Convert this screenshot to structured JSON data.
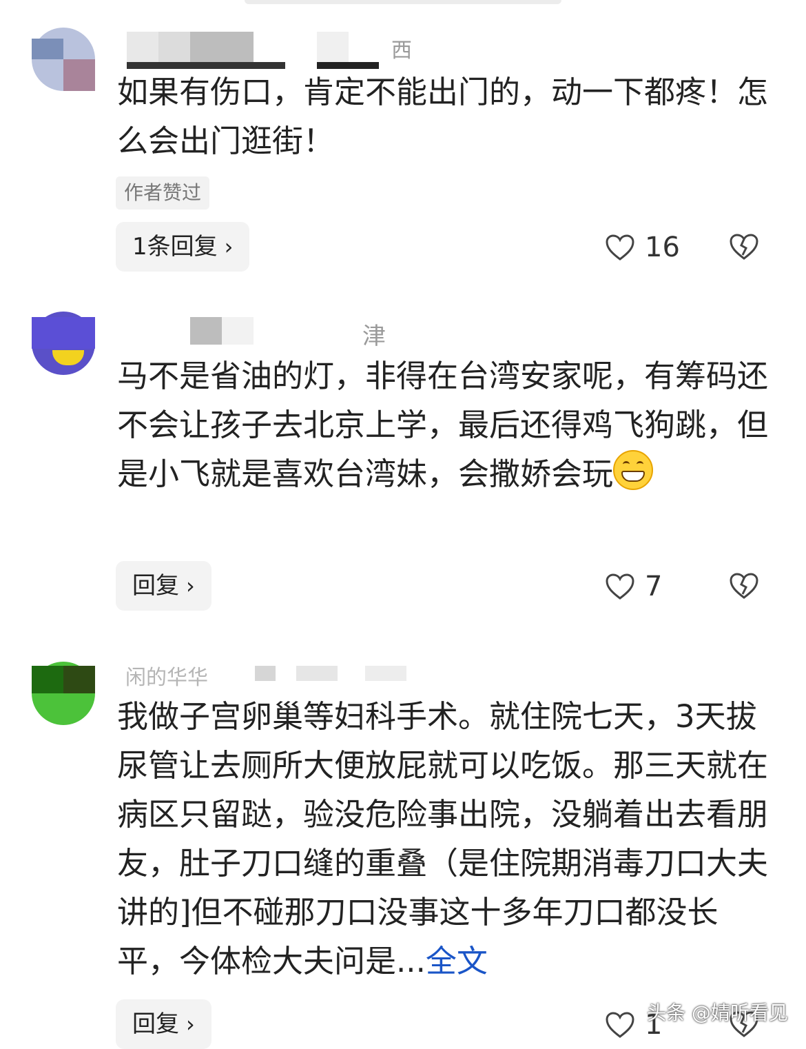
{
  "comments": [
    {
      "name_suffix": "西",
      "text": "如果有伤口，肯定不能出门的，动一下都疼！怎么会出门逛街！",
      "author_liked_tag": "作者赞过",
      "reply_label": "1条回复",
      "likes": "16"
    },
    {
      "name_suffix": "津",
      "text": "马不是省油的灯，非得在台湾安家呢，有筹码还不会让孩子去北京上学，最后还得鸡飞狗跳，但是小飞就是喜欢台湾妹，会撒娇会玩",
      "emoji": "grinning-emoji",
      "reply_label": "回复",
      "likes": "7"
    },
    {
      "name_partial": "闲的华华",
      "text": "我做子宫卵巢等妇科手术。就住院七天，3天拔尿管让去厕所大便放屁就可以吃饭。那三天就在病区只留跶，验没危险事出院，没躺着出去看朋友，肚子刀口缝的重叠（是住院期消毒刀口大夫讲的]但不碰那刀口没事这十多年刀口都没长平，今体检大夫问是...",
      "more_label": "全文",
      "reply_label": "回复",
      "likes": "1"
    }
  ],
  "icons": {
    "like": "heart-outline-icon",
    "dislike": "broken-heart-icon",
    "reply_chevron": "chevron-right-icon"
  },
  "watermark": "头条 @婧听看见"
}
